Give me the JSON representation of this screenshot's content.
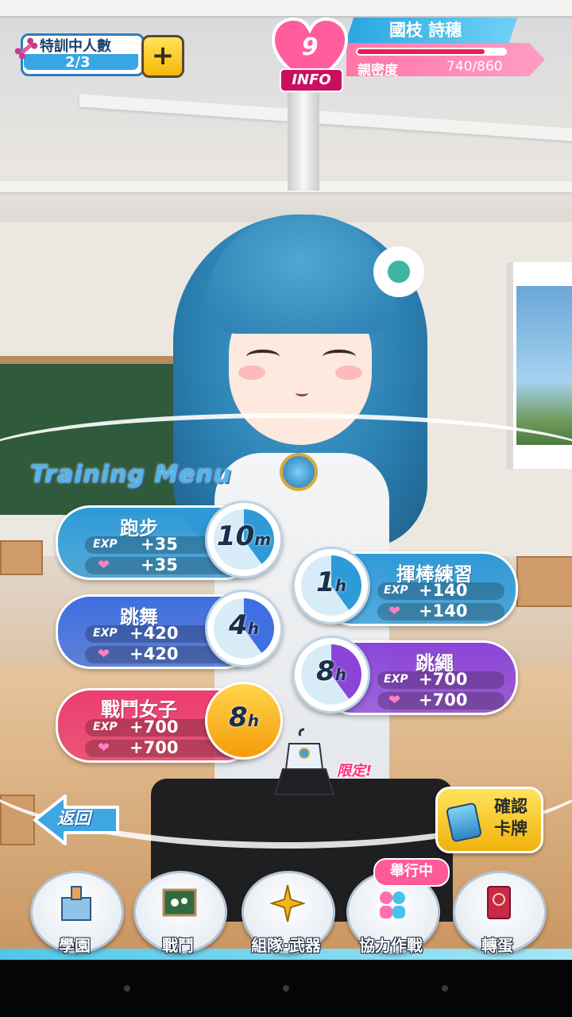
{
  "hud": {
    "training_label": "特訓中人數",
    "training_value": "2/3",
    "plus": "+",
    "character_name": "國枝 詩穗",
    "level": "9",
    "info": "INFO",
    "affinity_label": "親密度",
    "affinity_value": "740/860",
    "affinity_fraction": 0.86
  },
  "menu_title": "Training Menu",
  "trainings": [
    {
      "name": "跑步",
      "exp_tag": "EXP",
      "exp": "+35",
      "affinity": "+35",
      "time": "10",
      "unit": "m",
      "color": "#2e9ad8"
    },
    {
      "name": "跳舞",
      "exp_tag": "EXP",
      "exp": "+420",
      "affinity": "+420",
      "time": "4",
      "unit": "h",
      "color": "#3f6fe0"
    },
    {
      "name": "戰鬥女子",
      "exp_tag": "EXP",
      "exp": "+700",
      "affinity": "+700",
      "time": "8",
      "unit": "h",
      "color": "#ec3d70"
    },
    {
      "name": "揮棒練習",
      "exp_tag": "EXP",
      "exp": "+140",
      "affinity": "+140",
      "time": "1",
      "unit": "h",
      "color": "#2e9ad8"
    },
    {
      "name": "跳繩",
      "exp_tag": "EXP",
      "exp": "+700",
      "affinity": "+700",
      "time": "8",
      "unit": "h",
      "color": "#8a45d8"
    }
  ],
  "limited": "限定!",
  "back": "返回",
  "confirm_line1": "確認",
  "confirm_line2": "卡牌",
  "event_badge": "舉行中",
  "nav": [
    {
      "label": "學園",
      "icon": "school-icon"
    },
    {
      "label": "戰鬥",
      "icon": "battle-board-icon"
    },
    {
      "label": "組隊·武器",
      "icon": "compass-star-icon"
    },
    {
      "label": "協力作戰",
      "icon": "coop-icon"
    },
    {
      "label": "轉蛋",
      "icon": "gacha-card-icon"
    }
  ]
}
